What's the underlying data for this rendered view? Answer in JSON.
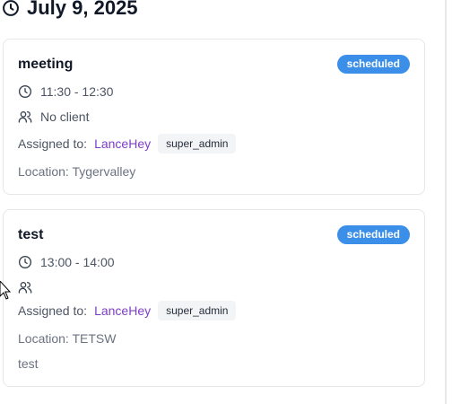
{
  "date_header": "July 9, 2025",
  "appointments": [
    {
      "title": "meeting",
      "status": "scheduled",
      "time": "11:30 - 12:30",
      "client": "No client",
      "assigned_label": "Assigned to:",
      "assignee": "LanceHey",
      "role": "super_admin",
      "location": "Location: Tygervalley",
      "notes": ""
    },
    {
      "title": "test",
      "status": "scheduled",
      "time": "13:00 - 14:00",
      "client": "",
      "assigned_label": "Assigned to:",
      "assignee": "LanceHey",
      "role": "super_admin",
      "location": "Location: TETSW",
      "notes": "test"
    }
  ],
  "colors": {
    "badge": "#3b8fe8",
    "assignee_link": "#7e3fc4",
    "tag_bg": "#f3f4f6"
  },
  "icons": [
    "clock-icon",
    "users-icon",
    "mouse-cursor-icon"
  ]
}
